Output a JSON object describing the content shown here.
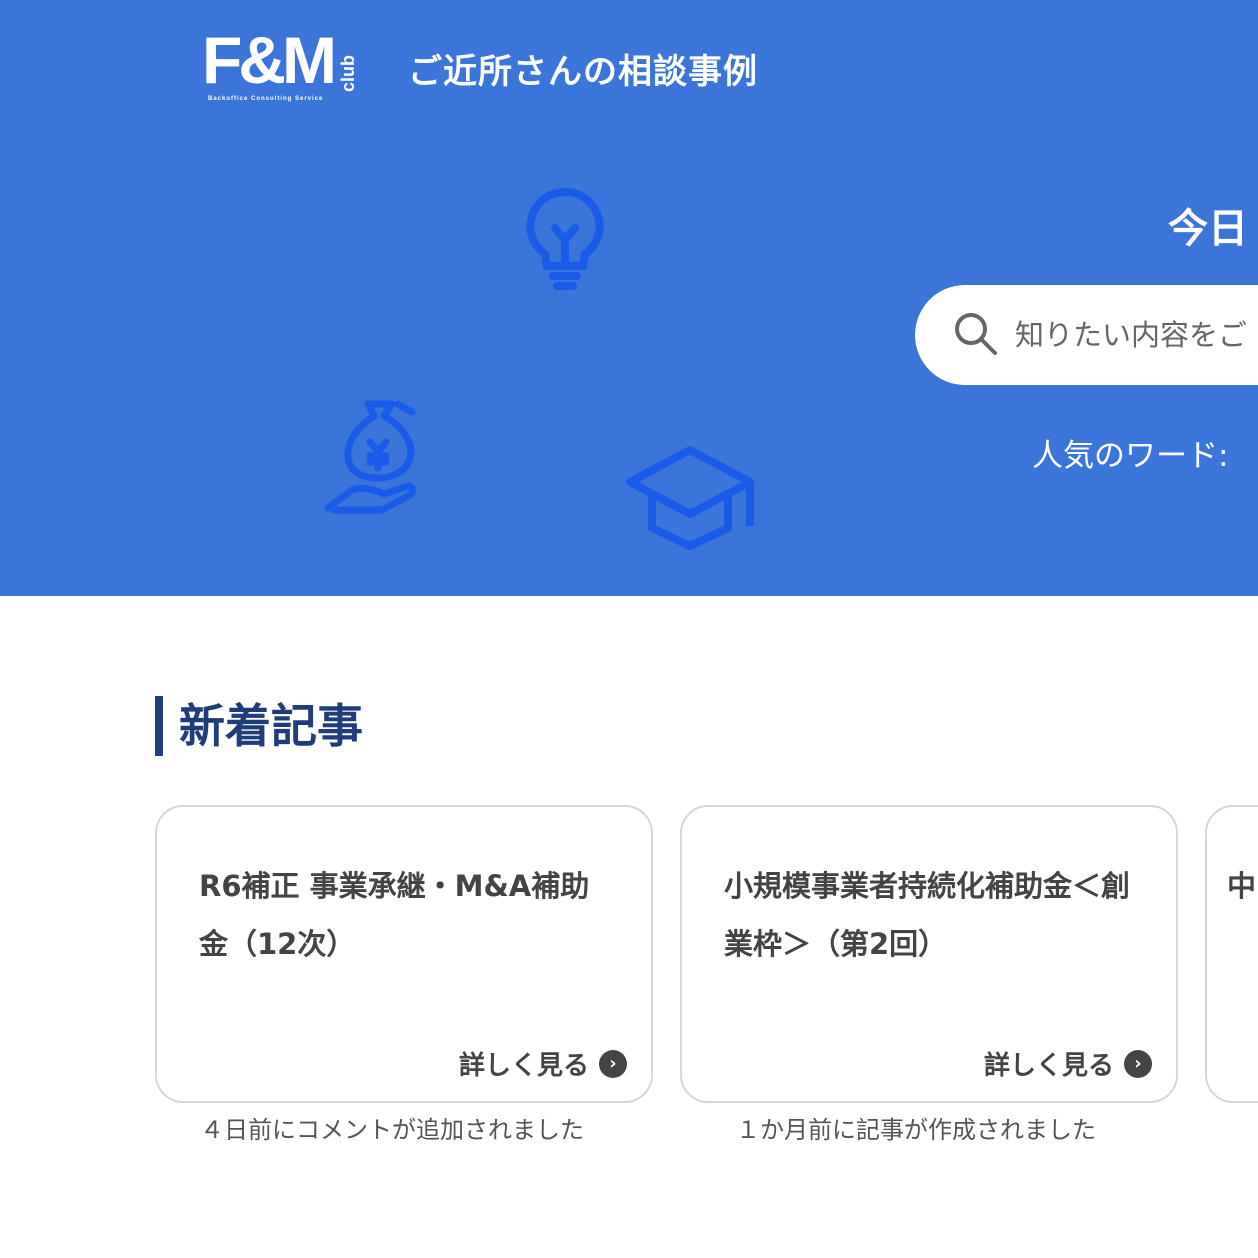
{
  "header": {
    "logo_text": "F&M",
    "logo_sub": "club",
    "logo_tagline": "Backoffice Consulting Service",
    "title": "ご近所さんの相談事例"
  },
  "hero": {
    "heading": "今日",
    "search_placeholder": "知りたい内容をご",
    "popular_label": "人気のワード:"
  },
  "icons": [
    "lightbulb-icon",
    "money-bag-hand-icon",
    "graduation-cap-icon",
    "search-icon"
  ],
  "section": {
    "title": "新着記事"
  },
  "cards": [
    {
      "title": "R6補正 事業承継・M&A補助金（12次）",
      "more": "詳しく見る",
      "note": "４日前にコメントが追加されました"
    },
    {
      "title": "小規模事業者持続化補助金＜創業枠＞（第2回）",
      "more": "詳しく見る",
      "note": "１か月前に記事が作成されました"
    },
    {
      "title": "中"
    }
  ],
  "colors": {
    "hero": "#3c75d9",
    "accent": "#1e3d7a",
    "icon": "#1a5ce8"
  }
}
